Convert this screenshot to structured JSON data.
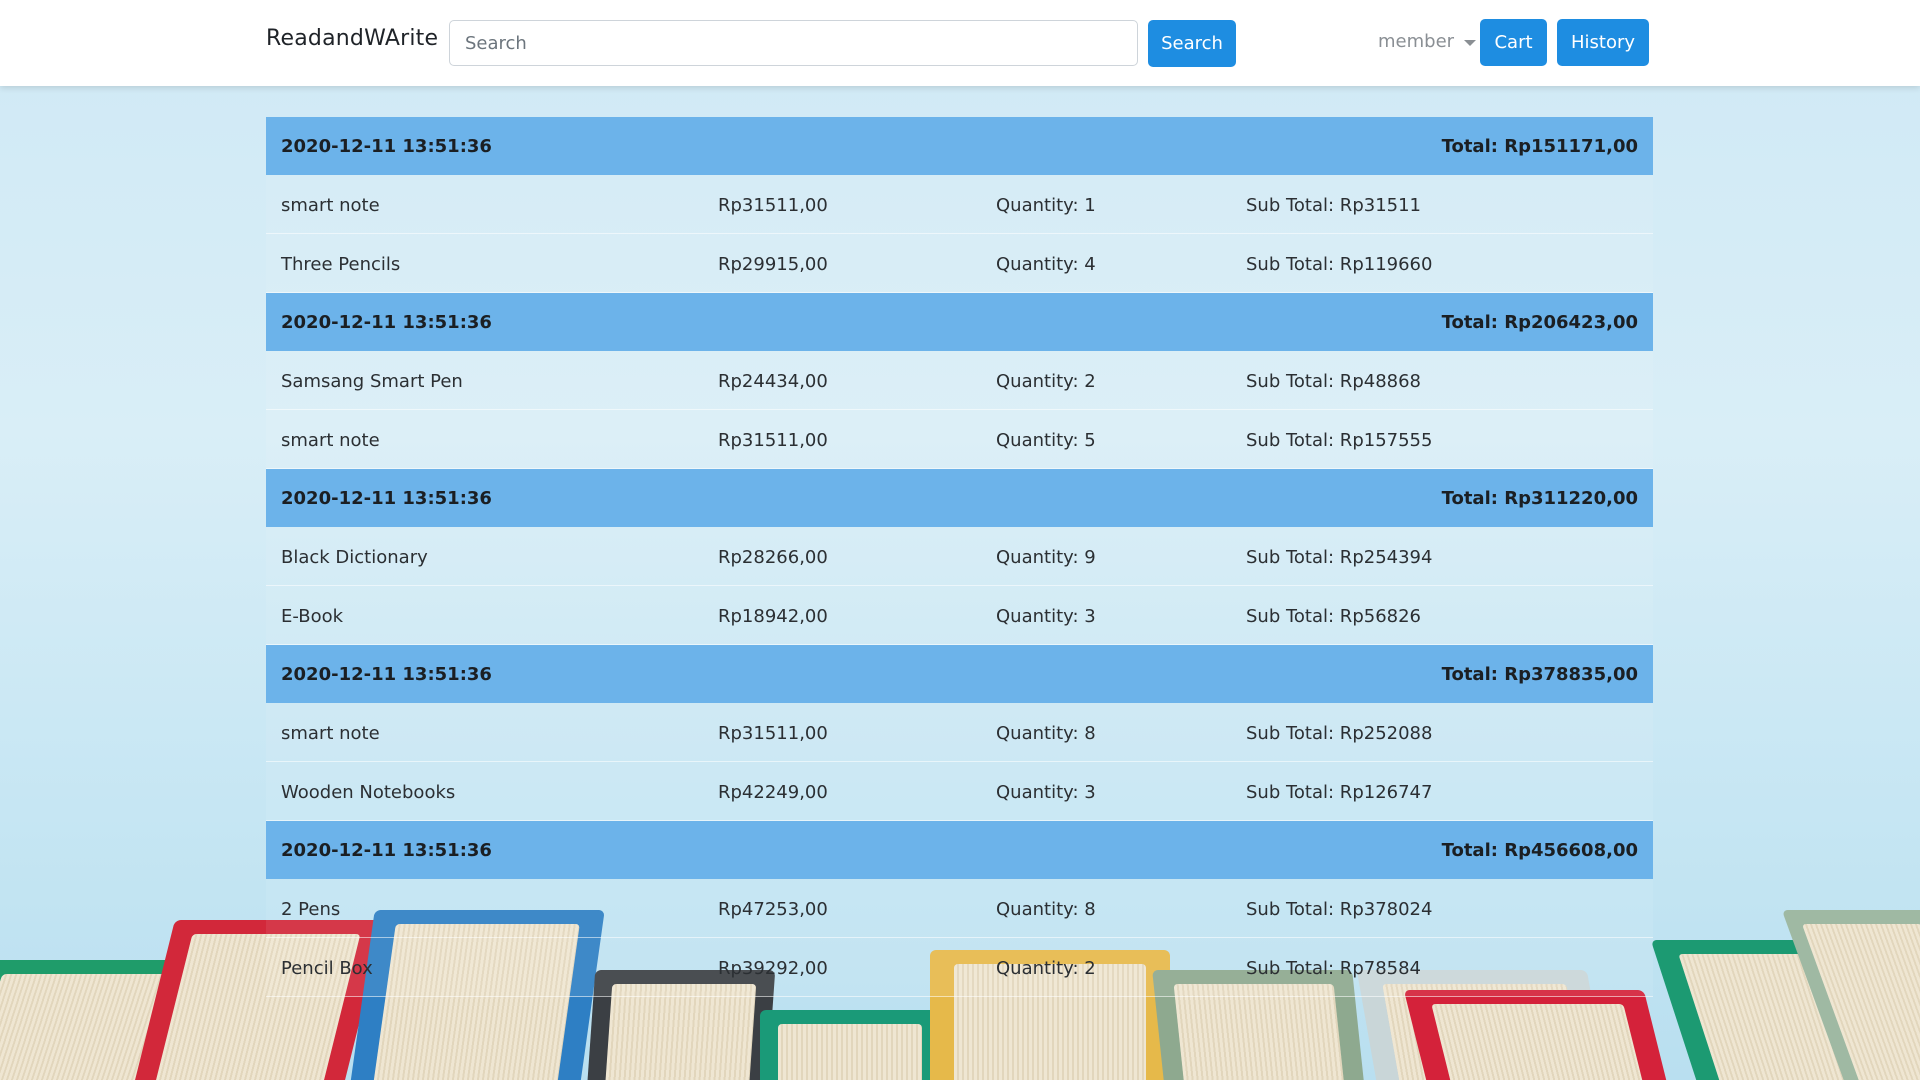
{
  "navbar": {
    "brand": "ReadandWArite",
    "search_placeholder": "Search",
    "search_button": "Search",
    "member_label": "member",
    "cart_button": "Cart",
    "history_button": "History"
  },
  "colors": {
    "primary_button": "#1e8de1",
    "order_header": "#6cb3ea",
    "navbar_bg": "#ffffff"
  },
  "orders": [
    {
      "date": "2020-12-11 13:51:36",
      "total": "Total: Rp151171,00",
      "items": [
        {
          "name": "smart note",
          "price": "Rp31511,00",
          "quantity": "Quantity: 1",
          "subtotal": "Sub Total: Rp31511"
        },
        {
          "name": "Three Pencils",
          "price": "Rp29915,00",
          "quantity": "Quantity: 4",
          "subtotal": "Sub Total: Rp119660"
        }
      ]
    },
    {
      "date": "2020-12-11 13:51:36",
      "total": "Total: Rp206423,00",
      "items": [
        {
          "name": "Samsang Smart Pen",
          "price": "Rp24434,00",
          "quantity": "Quantity: 2",
          "subtotal": "Sub Total: Rp48868"
        },
        {
          "name": "smart note",
          "price": "Rp31511,00",
          "quantity": "Quantity: 5",
          "subtotal": "Sub Total: Rp157555"
        }
      ]
    },
    {
      "date": "2020-12-11 13:51:36",
      "total": "Total: Rp311220,00",
      "items": [
        {
          "name": "Black Dictionary",
          "price": "Rp28266,00",
          "quantity": "Quantity: 9",
          "subtotal": "Sub Total: Rp254394"
        },
        {
          "name": "E-Book",
          "price": "Rp18942,00",
          "quantity": "Quantity: 3",
          "subtotal": "Sub Total: Rp56826"
        }
      ]
    },
    {
      "date": "2020-12-11 13:51:36",
      "total": "Total: Rp378835,00",
      "items": [
        {
          "name": "smart note",
          "price": "Rp31511,00",
          "quantity": "Quantity: 8",
          "subtotal": "Sub Total: Rp252088"
        },
        {
          "name": "Wooden Notebooks",
          "price": "Rp42249,00",
          "quantity": "Quantity: 3",
          "subtotal": "Sub Total: Rp126747"
        }
      ]
    },
    {
      "date": "2020-12-11 13:51:36",
      "total": "Total: Rp456608,00",
      "items": [
        {
          "name": "2 Pens",
          "price": "Rp47253,00",
          "quantity": "Quantity: 8",
          "subtotal": "Sub Total: Rp378024"
        },
        {
          "name": "Pencil Box",
          "price": "Rp39292,00",
          "quantity": "Quantity: 2",
          "subtotal": "Sub Total: Rp78584"
        }
      ]
    }
  ]
}
